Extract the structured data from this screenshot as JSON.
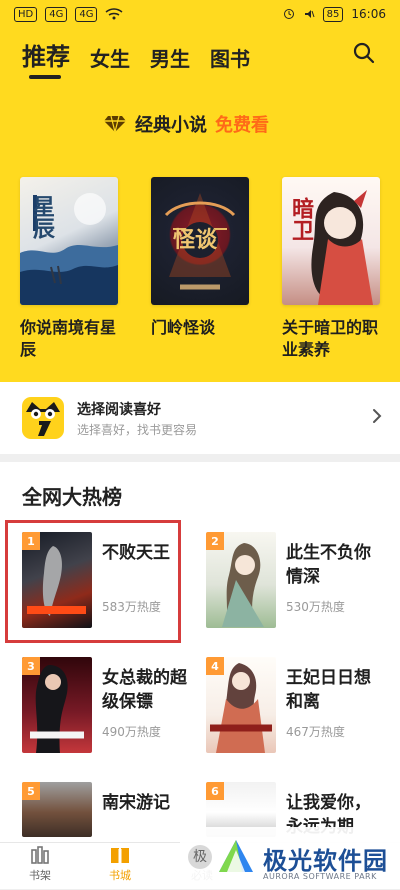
{
  "status": {
    "left": [
      "HD",
      "4G",
      "4G"
    ],
    "battery": "85",
    "time": "16:06"
  },
  "header": {
    "tabs": [
      "推荐",
      "女生",
      "男生",
      "图书"
    ],
    "banner_prefix": "经典小说",
    "banner_highlight": "免费看",
    "icons": [
      "search-icon",
      "diamond-icon"
    ]
  },
  "featured": [
    {
      "title": "你说南境有星辰",
      "cover_text": "星辰"
    },
    {
      "title": "门岭怪谈",
      "cover_text": "怪谈"
    },
    {
      "title": "关于暗卫的职业素养",
      "cover_text": "暗卫"
    }
  ],
  "preference": {
    "title": "选择阅读喜好",
    "subtitle": "选择喜好，找书更容易"
  },
  "rankings": {
    "title": "全网大热榜",
    "items": [
      {
        "rank": "1",
        "name": "不败天王",
        "heat": "583万热度"
      },
      {
        "rank": "2",
        "name": "此生不负你情深",
        "heat": "530万热度"
      },
      {
        "rank": "3",
        "name": "女总裁的超级保镖",
        "heat": "490万热度"
      },
      {
        "rank": "4",
        "name": "王妃日日想和离",
        "heat": "467万热度"
      },
      {
        "rank": "5",
        "name": "南宋游记",
        "heat": ""
      },
      {
        "rank": "6",
        "name": "让我爱你，永远为期",
        "heat": ""
      }
    ]
  },
  "bottom_nav": [
    {
      "label": "书架",
      "icon": "bookshelf-icon"
    },
    {
      "label": "书城",
      "icon": "book-city-icon"
    },
    {
      "label": "必读",
      "icon": "must-read-icon"
    }
  ],
  "watermark": {
    "title": "极光软件园",
    "subtitle": "AURORA SOFTWARE PARK",
    "left_char": "极"
  }
}
